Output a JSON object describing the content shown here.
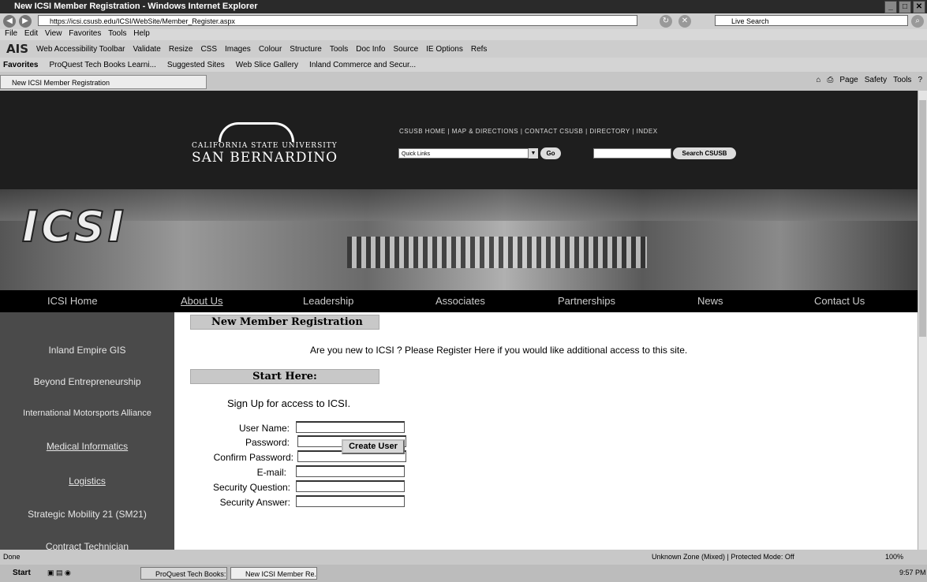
{
  "browser": {
    "window_title": "New ICSI Member Registration - Windows Internet Explorer",
    "address": "https://icsi.csusb.edu/ICSI/WebSite/Member_Register.aspx",
    "search_placeholder": "Live Search",
    "menu": [
      "File",
      "Edit",
      "View",
      "Favorites",
      "Tools",
      "Help"
    ],
    "toolbar": [
      "Web Accessibility Toolbar",
      "Validate",
      "Resize",
      "CSS",
      "Images",
      "Colour",
      "Structure",
      "Tools",
      "Doc Info",
      "Source",
      "IE Options",
      "Refs"
    ],
    "favorites_label": "Favorites",
    "favorites": [
      "ProQuest Tech Books Learni...",
      "Suggested Sites",
      "Web Slice Gallery",
      "Inland Commerce and Secur..."
    ],
    "tab_title": "New ICSI Member Registration",
    "command_bar": [
      "Page",
      "Safety",
      "Tools"
    ],
    "status": "Done",
    "zone": "Unknown Zone (Mixed) | Protected Mode: Off",
    "zoom": "100%"
  },
  "site": {
    "logo_line1": "CALIFORNIA STATE UNIVERSITY",
    "logo_line2": "SAN BERNARDINO",
    "top_links": "CSUSB HOME  |  MAP & DIRECTIONS  |  CONTACT CSUSB  |  DIRECTORY  |  INDEX",
    "quick_links": "Quick Links",
    "go_button": "Go",
    "search_button": "Search CSUSB",
    "hero_text": "ICSI",
    "nav": [
      "ICSI Home",
      "About Us",
      "Leadership",
      "Associates",
      "Partnerships",
      "News",
      "Contact Us"
    ],
    "sidebar": [
      "Inland Empire GIS",
      "Beyond Entrepreneurship",
      "International Motorsports Alliance",
      "Medical Informatics",
      "Logistics",
      "Strategic Mobility 21 (SM21)",
      "Contract Technician"
    ]
  },
  "main": {
    "header": "New Member Registration",
    "intro": "Are you new to ICSI ? Please Register Here if you would like additional access to this site.",
    "start_header": "Start Here:",
    "signup_text": "Sign Up for access to ICSI.",
    "fields": [
      {
        "label": "User Name:",
        "value": ""
      },
      {
        "label": "Password:",
        "value": ""
      },
      {
        "label": "Confirm Password:",
        "value": ""
      },
      {
        "label": "E-mail:",
        "value": ""
      },
      {
        "label": "Security Question:",
        "value": ""
      },
      {
        "label": "Security Answer:",
        "value": ""
      }
    ],
    "create_button": "Create User"
  },
  "taskbar": {
    "start": "Start",
    "items": [
      "ProQuest Tech Books: Le...",
      "New ICSI Member Re..."
    ],
    "clock": "9:57 PM"
  }
}
